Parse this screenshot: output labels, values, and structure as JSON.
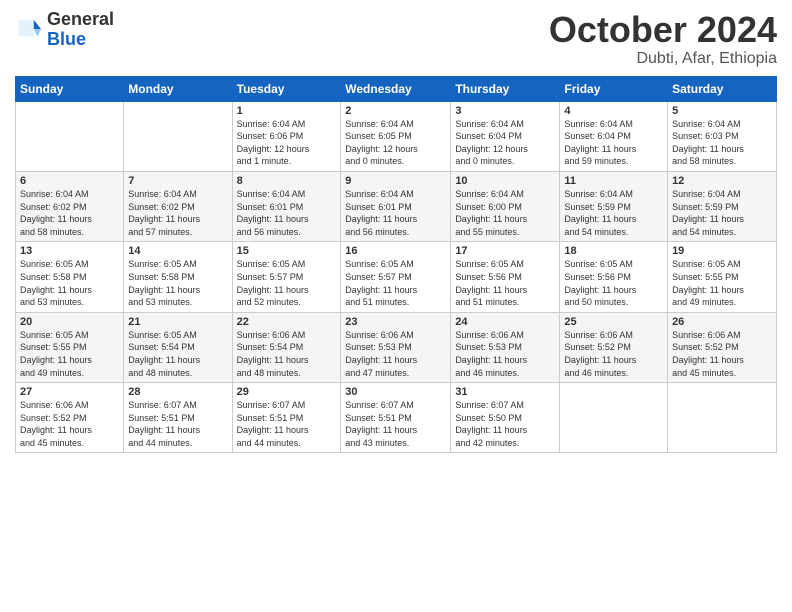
{
  "logo": {
    "line1": "General",
    "line2": "Blue"
  },
  "title": "October 2024",
  "location": "Dubti, Afar, Ethiopia",
  "weekdays": [
    "Sunday",
    "Monday",
    "Tuesday",
    "Wednesday",
    "Thursday",
    "Friday",
    "Saturday"
  ],
  "weeks": [
    [
      {
        "day": "",
        "info": ""
      },
      {
        "day": "",
        "info": ""
      },
      {
        "day": "1",
        "info": "Sunrise: 6:04 AM\nSunset: 6:06 PM\nDaylight: 12 hours\nand 1 minute."
      },
      {
        "day": "2",
        "info": "Sunrise: 6:04 AM\nSunset: 6:05 PM\nDaylight: 12 hours\nand 0 minutes."
      },
      {
        "day": "3",
        "info": "Sunrise: 6:04 AM\nSunset: 6:04 PM\nDaylight: 12 hours\nand 0 minutes."
      },
      {
        "day": "4",
        "info": "Sunrise: 6:04 AM\nSunset: 6:04 PM\nDaylight: 11 hours\nand 59 minutes."
      },
      {
        "day": "5",
        "info": "Sunrise: 6:04 AM\nSunset: 6:03 PM\nDaylight: 11 hours\nand 58 minutes."
      }
    ],
    [
      {
        "day": "6",
        "info": "Sunrise: 6:04 AM\nSunset: 6:02 PM\nDaylight: 11 hours\nand 58 minutes."
      },
      {
        "day": "7",
        "info": "Sunrise: 6:04 AM\nSunset: 6:02 PM\nDaylight: 11 hours\nand 57 minutes."
      },
      {
        "day": "8",
        "info": "Sunrise: 6:04 AM\nSunset: 6:01 PM\nDaylight: 11 hours\nand 56 minutes."
      },
      {
        "day": "9",
        "info": "Sunrise: 6:04 AM\nSunset: 6:01 PM\nDaylight: 11 hours\nand 56 minutes."
      },
      {
        "day": "10",
        "info": "Sunrise: 6:04 AM\nSunset: 6:00 PM\nDaylight: 11 hours\nand 55 minutes."
      },
      {
        "day": "11",
        "info": "Sunrise: 6:04 AM\nSunset: 5:59 PM\nDaylight: 11 hours\nand 54 minutes."
      },
      {
        "day": "12",
        "info": "Sunrise: 6:04 AM\nSunset: 5:59 PM\nDaylight: 11 hours\nand 54 minutes."
      }
    ],
    [
      {
        "day": "13",
        "info": "Sunrise: 6:05 AM\nSunset: 5:58 PM\nDaylight: 11 hours\nand 53 minutes."
      },
      {
        "day": "14",
        "info": "Sunrise: 6:05 AM\nSunset: 5:58 PM\nDaylight: 11 hours\nand 53 minutes."
      },
      {
        "day": "15",
        "info": "Sunrise: 6:05 AM\nSunset: 5:57 PM\nDaylight: 11 hours\nand 52 minutes."
      },
      {
        "day": "16",
        "info": "Sunrise: 6:05 AM\nSunset: 5:57 PM\nDaylight: 11 hours\nand 51 minutes."
      },
      {
        "day": "17",
        "info": "Sunrise: 6:05 AM\nSunset: 5:56 PM\nDaylight: 11 hours\nand 51 minutes."
      },
      {
        "day": "18",
        "info": "Sunrise: 6:05 AM\nSunset: 5:56 PM\nDaylight: 11 hours\nand 50 minutes."
      },
      {
        "day": "19",
        "info": "Sunrise: 6:05 AM\nSunset: 5:55 PM\nDaylight: 11 hours\nand 49 minutes."
      }
    ],
    [
      {
        "day": "20",
        "info": "Sunrise: 6:05 AM\nSunset: 5:55 PM\nDaylight: 11 hours\nand 49 minutes."
      },
      {
        "day": "21",
        "info": "Sunrise: 6:05 AM\nSunset: 5:54 PM\nDaylight: 11 hours\nand 48 minutes."
      },
      {
        "day": "22",
        "info": "Sunrise: 6:06 AM\nSunset: 5:54 PM\nDaylight: 11 hours\nand 48 minutes."
      },
      {
        "day": "23",
        "info": "Sunrise: 6:06 AM\nSunset: 5:53 PM\nDaylight: 11 hours\nand 47 minutes."
      },
      {
        "day": "24",
        "info": "Sunrise: 6:06 AM\nSunset: 5:53 PM\nDaylight: 11 hours\nand 46 minutes."
      },
      {
        "day": "25",
        "info": "Sunrise: 6:06 AM\nSunset: 5:52 PM\nDaylight: 11 hours\nand 46 minutes."
      },
      {
        "day": "26",
        "info": "Sunrise: 6:06 AM\nSunset: 5:52 PM\nDaylight: 11 hours\nand 45 minutes."
      }
    ],
    [
      {
        "day": "27",
        "info": "Sunrise: 6:06 AM\nSunset: 5:52 PM\nDaylight: 11 hours\nand 45 minutes."
      },
      {
        "day": "28",
        "info": "Sunrise: 6:07 AM\nSunset: 5:51 PM\nDaylight: 11 hours\nand 44 minutes."
      },
      {
        "day": "29",
        "info": "Sunrise: 6:07 AM\nSunset: 5:51 PM\nDaylight: 11 hours\nand 44 minutes."
      },
      {
        "day": "30",
        "info": "Sunrise: 6:07 AM\nSunset: 5:51 PM\nDaylight: 11 hours\nand 43 minutes."
      },
      {
        "day": "31",
        "info": "Sunrise: 6:07 AM\nSunset: 5:50 PM\nDaylight: 11 hours\nand 42 minutes."
      },
      {
        "day": "",
        "info": ""
      },
      {
        "day": "",
        "info": ""
      }
    ]
  ]
}
